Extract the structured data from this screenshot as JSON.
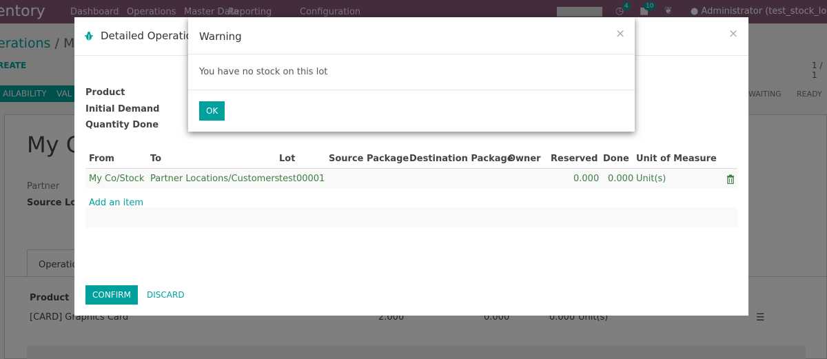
{
  "app": {
    "name": "entory",
    "menu": [
      "Dashboard",
      "Operations",
      "Master Data",
      "Reporting",
      "Configuration"
    ],
    "notif_badge_1": "4",
    "notif_badge_2": "10",
    "user": "Administrator (test_stock_lot_v"
  },
  "background": {
    "breadcrumb_root": "erations",
    "breadcrumb_sep": " / ",
    "breadcrumb_current": "My",
    "create_label": "REATE",
    "pager": "1 / 1",
    "btn_availability": "AILABILITY",
    "btn_validate": "VAL",
    "status_waiting": "WAITING",
    "status_ready": "READY",
    "record_title": "My C",
    "label_partner": "Partner",
    "label_source_location": "Source Loca",
    "tab_operations": "Operatio",
    "col_product": "Product",
    "row_product": "[CARD] Graphics Card",
    "row_initial": "2.000",
    "row_reserved": "0.000",
    "row_done": "0.000",
    "row_uom": "Unit(s)"
  },
  "dialog": {
    "title": "Detailed Operation",
    "fields": {
      "product": "Product",
      "initial_demand": "Initial Demand",
      "quantity_done": "Quantity Done"
    },
    "columns": [
      "From",
      "To",
      "Lot",
      "Source Package",
      "Destination Package",
      "Owner",
      "Reserved",
      "Done",
      "Unit of Measure"
    ],
    "rows": [
      {
        "from": "My Co/Stock",
        "to": "Partner Locations/Customers",
        "lot": "test00001",
        "source_package": "",
        "destination_package": "",
        "owner": "",
        "reserved": "0.000",
        "done": "0.000",
        "uom": "Unit(s)"
      }
    ],
    "add_item": "Add an item",
    "confirm": "Confirm",
    "discard": "Discard"
  },
  "warning": {
    "title": "Warning",
    "message": "You have no stock on this lot",
    "ok": "OK",
    "close": "×"
  },
  "colors": {
    "primary": "#00a09d",
    "topbar": "#875a7b",
    "line_text": "#3f7e3f"
  }
}
